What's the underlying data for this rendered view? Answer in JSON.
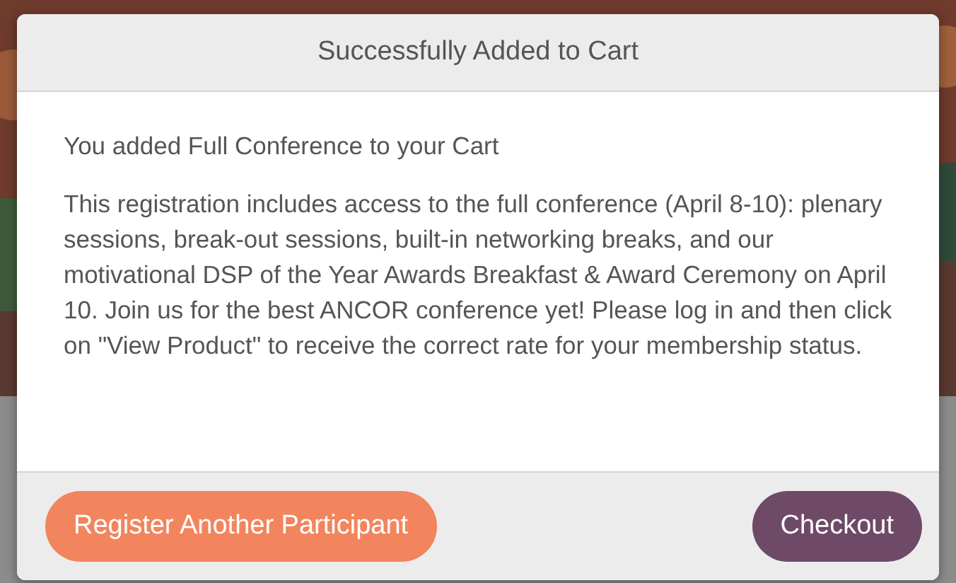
{
  "dialog": {
    "title": "Successfully Added to Cart",
    "message": "You added Full Conference to your Cart",
    "description": "This registration includes access to the full conference (April 8-10): plenary sessions, break-out sessions, built-in networking breaks, and our motivational DSP of the Year Awards Breakfast & Award Ceremony on April 10. Join us for the best ANCOR conference yet! Please log in and then click on \"View Product\" to receive the correct rate for your membership status.",
    "buttons": [
      {
        "label": "Register Another Participant",
        "kind": "secondary"
      },
      {
        "label": "Checkout",
        "kind": "primary"
      }
    ]
  }
}
